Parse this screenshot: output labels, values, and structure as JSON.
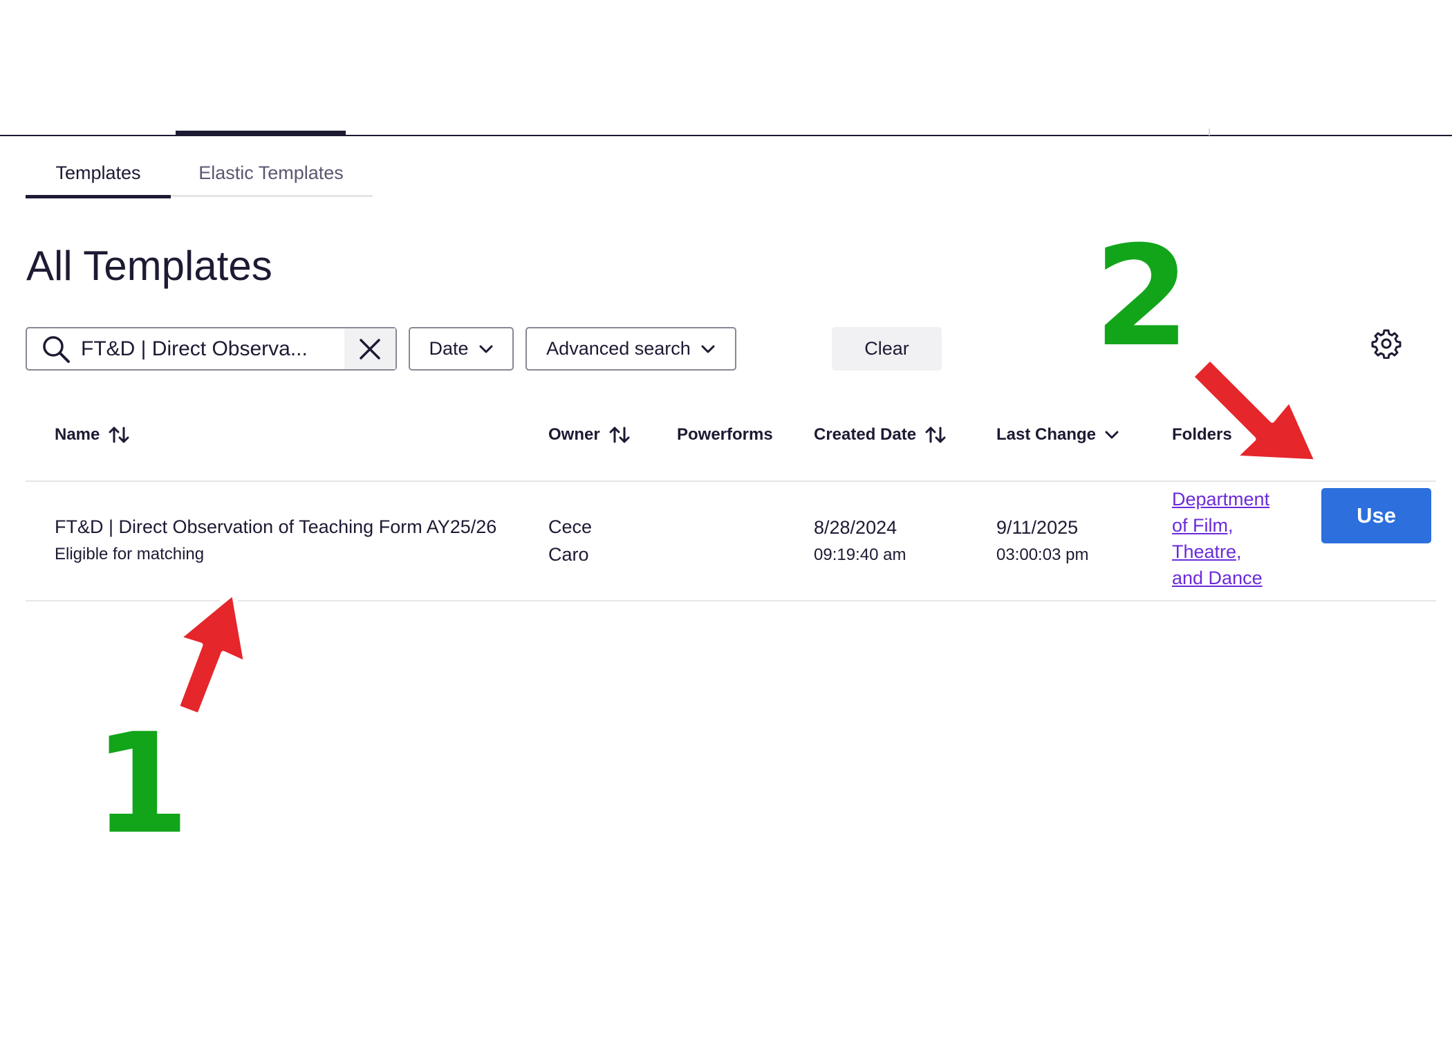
{
  "tabs": [
    {
      "label": "Templates",
      "active": true
    },
    {
      "label": "Elastic Templates",
      "active": false
    }
  ],
  "page_title": "All Templates",
  "search": {
    "value": "FT&D | Direct Observa..."
  },
  "filters": {
    "date_label": "Date",
    "advanced_label": "Advanced search",
    "clear_label": "Clear"
  },
  "table": {
    "columns": {
      "name": "Name",
      "owner": "Owner",
      "powerforms": "Powerforms",
      "created": "Created Date",
      "last_change": "Last Change",
      "folders": "Folders"
    },
    "rows": [
      {
        "name": "FT&D | Direct Observation of Teaching Form AY25/26",
        "status": "Eligible for matching",
        "owner_first": "Cece",
        "owner_last": "Caro",
        "powerforms": "",
        "created_date": "8/28/2024",
        "created_time": "09:19:40 am",
        "changed_date": "9/11/2025",
        "changed_time": "03:00:03 pm",
        "folder_lines": [
          "Department",
          "of Film,",
          "Theatre,",
          "and Dance"
        ],
        "action_label": "Use"
      }
    ]
  },
  "annotations": {
    "step1": "1",
    "step2": "2"
  },
  "colors": {
    "accent": "#2c6fdd",
    "link": "#6b2bd9",
    "step": "#12a51a",
    "arrow": "#e5262b"
  }
}
